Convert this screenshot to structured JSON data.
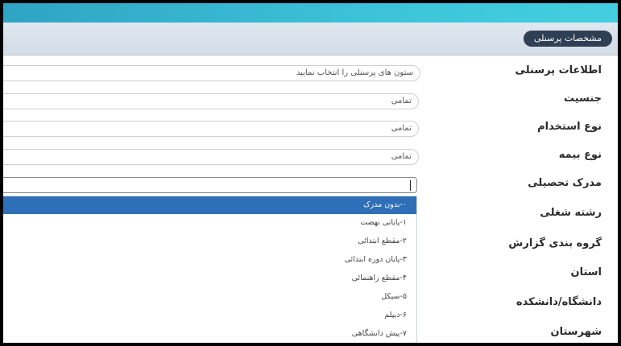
{
  "header": {
    "pill_label": "مشخصات پرسنلی"
  },
  "form": {
    "rows": [
      {
        "label": "اطلاعات پرسنلی",
        "value": "ستون های پرسنلی را انتخاب نمایید"
      },
      {
        "label": "جنسیت",
        "value": "تمامی"
      },
      {
        "label": "نوع استخدام",
        "value": "تمامی"
      },
      {
        "label": "نوع بیمه",
        "value": "تمامی"
      },
      {
        "label": "مدرک تحصیلی",
        "value": ""
      },
      {
        "label": "رشته شغلی"
      },
      {
        "label": "گروه بندی گزارش"
      },
      {
        "label": "استان"
      },
      {
        "label": "دانشگاه/دانشکده"
      },
      {
        "label": "شهرستان"
      }
    ]
  },
  "dropdown": {
    "selected_index": 0,
    "options": [
      "۰-بدون مدرک",
      "۱-پایانی نهضت",
      "۲-مقطع ابتدائی",
      "۳-پایان دوره ابتدائی",
      "۴-مقطع راهنمائی",
      "۵-سیکل",
      "۶-دیپلم",
      "۷-پیش دانشگاهی"
    ]
  },
  "colors": {
    "top_bar": "#3cc3d9",
    "header_bg": "#d8e1ea",
    "pill_bg": "#2f3f54",
    "selected_option_bg": "#2e6fb8"
  }
}
